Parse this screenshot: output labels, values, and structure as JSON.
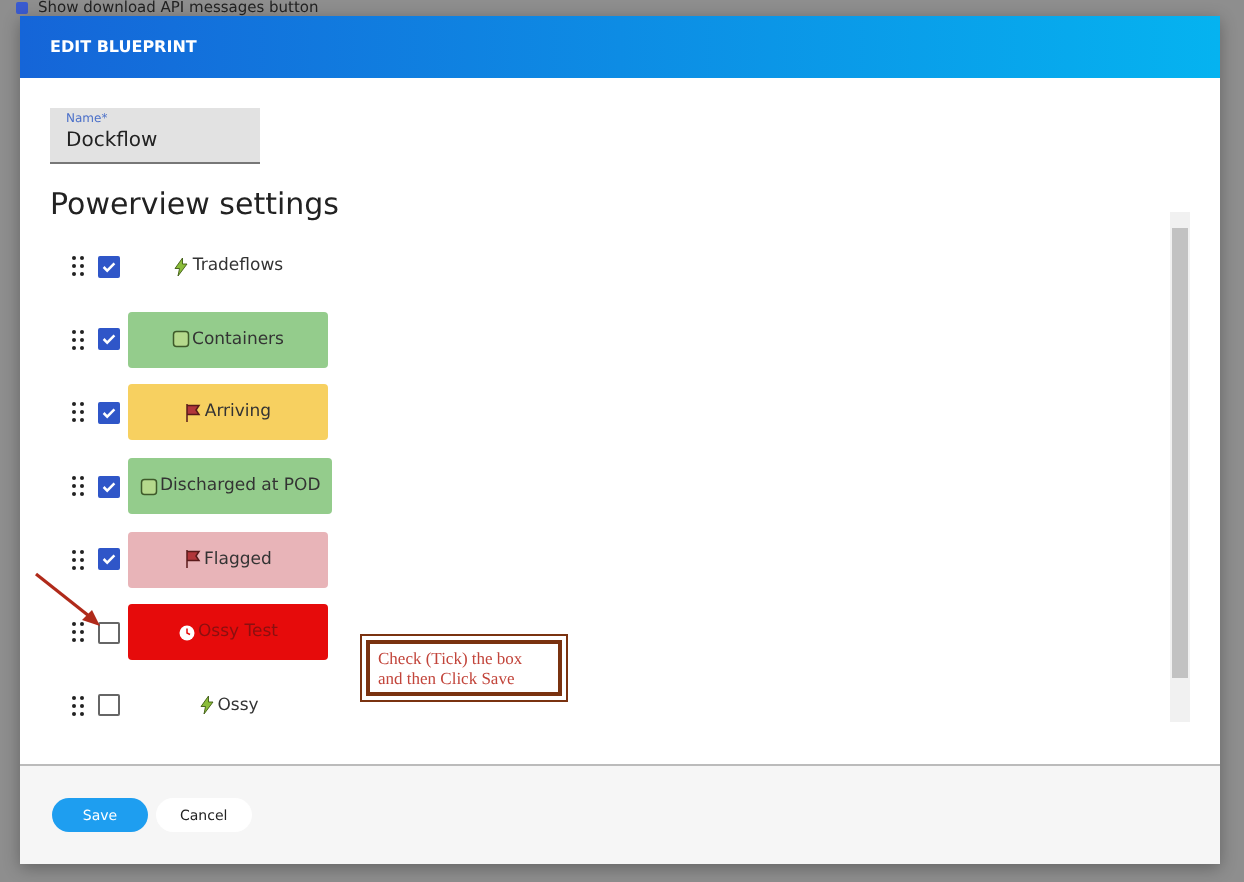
{
  "background": {
    "option_label": "Show download API messages button",
    "checked": true
  },
  "dialog": {
    "title": "EDIT BLUEPRINT",
    "name_field": {
      "label": "Name*",
      "value": "Dockflow"
    },
    "section_title": "Powerview settings",
    "items": [
      {
        "label": "Tradeflows",
        "checked": true,
        "kind": "flow"
      },
      {
        "label": "Containers",
        "checked": true,
        "kind": "box",
        "color": "#94cc8c"
      },
      {
        "label": "Arriving",
        "checked": true,
        "kind": "flag",
        "color": "#f7d060"
      },
      {
        "label": "Discharged at POD",
        "checked": true,
        "kind": "box",
        "color": "#94cc8c"
      },
      {
        "label": "Flagged",
        "checked": true,
        "kind": "flag",
        "color": "#e8b4b8"
      },
      {
        "label": "Ossy Test",
        "checked": false,
        "kind": "alert",
        "color": "#e60b0b"
      },
      {
        "label": "Ossy",
        "checked": false,
        "kind": "flow"
      }
    ],
    "callout": "Check (Tick) the box and then Click Save",
    "buttons": [
      {
        "label": "Save",
        "kind": "primary"
      },
      {
        "label": "Cancel",
        "kind": "secondary"
      }
    ]
  }
}
